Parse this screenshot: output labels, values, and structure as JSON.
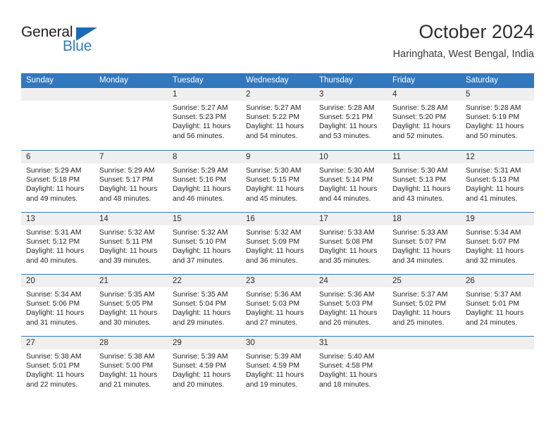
{
  "brand": {
    "name_dark": "General",
    "name_blue": "Blue",
    "accent_color": "#2b7fc4",
    "triangle_color": "#1b6cb5"
  },
  "header": {
    "month_title": "October 2024",
    "location": "Haringhata, West Bengal, India"
  },
  "theme": {
    "header_blue": "#3278be",
    "daynum_band": "#efefef",
    "text": "#262626"
  },
  "weekday_headers": [
    "Sunday",
    "Monday",
    "Tuesday",
    "Wednesday",
    "Thursday",
    "Friday",
    "Saturday"
  ],
  "weeks": [
    [
      {
        "day": "",
        "sunrise": "",
        "sunset": "",
        "daylight_a": "",
        "daylight_b": ""
      },
      {
        "day": "",
        "sunrise": "",
        "sunset": "",
        "daylight_a": "",
        "daylight_b": ""
      },
      {
        "day": "1",
        "sunrise": "Sunrise: 5:27 AM",
        "sunset": "Sunset: 5:23 PM",
        "daylight_a": "Daylight: 11 hours",
        "daylight_b": "and 56 minutes."
      },
      {
        "day": "2",
        "sunrise": "Sunrise: 5:27 AM",
        "sunset": "Sunset: 5:22 PM",
        "daylight_a": "Daylight: 11 hours",
        "daylight_b": "and 54 minutes."
      },
      {
        "day": "3",
        "sunrise": "Sunrise: 5:28 AM",
        "sunset": "Sunset: 5:21 PM",
        "daylight_a": "Daylight: 11 hours",
        "daylight_b": "and 53 minutes."
      },
      {
        "day": "4",
        "sunrise": "Sunrise: 5:28 AM",
        "sunset": "Sunset: 5:20 PM",
        "daylight_a": "Daylight: 11 hours",
        "daylight_b": "and 52 minutes."
      },
      {
        "day": "5",
        "sunrise": "Sunrise: 5:28 AM",
        "sunset": "Sunset: 5:19 PM",
        "daylight_a": "Daylight: 11 hours",
        "daylight_b": "and 50 minutes."
      }
    ],
    [
      {
        "day": "6",
        "sunrise": "Sunrise: 5:29 AM",
        "sunset": "Sunset: 5:18 PM",
        "daylight_a": "Daylight: 11 hours",
        "daylight_b": "and 49 minutes."
      },
      {
        "day": "7",
        "sunrise": "Sunrise: 5:29 AM",
        "sunset": "Sunset: 5:17 PM",
        "daylight_a": "Daylight: 11 hours",
        "daylight_b": "and 48 minutes."
      },
      {
        "day": "8",
        "sunrise": "Sunrise: 5:29 AM",
        "sunset": "Sunset: 5:16 PM",
        "daylight_a": "Daylight: 11 hours",
        "daylight_b": "and 46 minutes."
      },
      {
        "day": "9",
        "sunrise": "Sunrise: 5:30 AM",
        "sunset": "Sunset: 5:15 PM",
        "daylight_a": "Daylight: 11 hours",
        "daylight_b": "and 45 minutes."
      },
      {
        "day": "10",
        "sunrise": "Sunrise: 5:30 AM",
        "sunset": "Sunset: 5:14 PM",
        "daylight_a": "Daylight: 11 hours",
        "daylight_b": "and 44 minutes."
      },
      {
        "day": "11",
        "sunrise": "Sunrise: 5:30 AM",
        "sunset": "Sunset: 5:13 PM",
        "daylight_a": "Daylight: 11 hours",
        "daylight_b": "and 43 minutes."
      },
      {
        "day": "12",
        "sunrise": "Sunrise: 5:31 AM",
        "sunset": "Sunset: 5:13 PM",
        "daylight_a": "Daylight: 11 hours",
        "daylight_b": "and 41 minutes."
      }
    ],
    [
      {
        "day": "13",
        "sunrise": "Sunrise: 5:31 AM",
        "sunset": "Sunset: 5:12 PM",
        "daylight_a": "Daylight: 11 hours",
        "daylight_b": "and 40 minutes."
      },
      {
        "day": "14",
        "sunrise": "Sunrise: 5:32 AM",
        "sunset": "Sunset: 5:11 PM",
        "daylight_a": "Daylight: 11 hours",
        "daylight_b": "and 39 minutes."
      },
      {
        "day": "15",
        "sunrise": "Sunrise: 5:32 AM",
        "sunset": "Sunset: 5:10 PM",
        "daylight_a": "Daylight: 11 hours",
        "daylight_b": "and 37 minutes."
      },
      {
        "day": "16",
        "sunrise": "Sunrise: 5:32 AM",
        "sunset": "Sunset: 5:09 PM",
        "daylight_a": "Daylight: 11 hours",
        "daylight_b": "and 36 minutes."
      },
      {
        "day": "17",
        "sunrise": "Sunrise: 5:33 AM",
        "sunset": "Sunset: 5:08 PM",
        "daylight_a": "Daylight: 11 hours",
        "daylight_b": "and 35 minutes."
      },
      {
        "day": "18",
        "sunrise": "Sunrise: 5:33 AM",
        "sunset": "Sunset: 5:07 PM",
        "daylight_a": "Daylight: 11 hours",
        "daylight_b": "and 34 minutes."
      },
      {
        "day": "19",
        "sunrise": "Sunrise: 5:34 AM",
        "sunset": "Sunset: 5:07 PM",
        "daylight_a": "Daylight: 11 hours",
        "daylight_b": "and 32 minutes."
      }
    ],
    [
      {
        "day": "20",
        "sunrise": "Sunrise: 5:34 AM",
        "sunset": "Sunset: 5:06 PM",
        "daylight_a": "Daylight: 11 hours",
        "daylight_b": "and 31 minutes."
      },
      {
        "day": "21",
        "sunrise": "Sunrise: 5:35 AM",
        "sunset": "Sunset: 5:05 PM",
        "daylight_a": "Daylight: 11 hours",
        "daylight_b": "and 30 minutes."
      },
      {
        "day": "22",
        "sunrise": "Sunrise: 5:35 AM",
        "sunset": "Sunset: 5:04 PM",
        "daylight_a": "Daylight: 11 hours",
        "daylight_b": "and 29 minutes."
      },
      {
        "day": "23",
        "sunrise": "Sunrise: 5:36 AM",
        "sunset": "Sunset: 5:03 PM",
        "daylight_a": "Daylight: 11 hours",
        "daylight_b": "and 27 minutes."
      },
      {
        "day": "24",
        "sunrise": "Sunrise: 5:36 AM",
        "sunset": "Sunset: 5:03 PM",
        "daylight_a": "Daylight: 11 hours",
        "daylight_b": "and 26 minutes."
      },
      {
        "day": "25",
        "sunrise": "Sunrise: 5:37 AM",
        "sunset": "Sunset: 5:02 PM",
        "daylight_a": "Daylight: 11 hours",
        "daylight_b": "and 25 minutes."
      },
      {
        "day": "26",
        "sunrise": "Sunrise: 5:37 AM",
        "sunset": "Sunset: 5:01 PM",
        "daylight_a": "Daylight: 11 hours",
        "daylight_b": "and 24 minutes."
      }
    ],
    [
      {
        "day": "27",
        "sunrise": "Sunrise: 5:38 AM",
        "sunset": "Sunset: 5:01 PM",
        "daylight_a": "Daylight: 11 hours",
        "daylight_b": "and 22 minutes."
      },
      {
        "day": "28",
        "sunrise": "Sunrise: 5:38 AM",
        "sunset": "Sunset: 5:00 PM",
        "daylight_a": "Daylight: 11 hours",
        "daylight_b": "and 21 minutes."
      },
      {
        "day": "29",
        "sunrise": "Sunrise: 5:39 AM",
        "sunset": "Sunset: 4:59 PM",
        "daylight_a": "Daylight: 11 hours",
        "daylight_b": "and 20 minutes."
      },
      {
        "day": "30",
        "sunrise": "Sunrise: 5:39 AM",
        "sunset": "Sunset: 4:59 PM",
        "daylight_a": "Daylight: 11 hours",
        "daylight_b": "and 19 minutes."
      },
      {
        "day": "31",
        "sunrise": "Sunrise: 5:40 AM",
        "sunset": "Sunset: 4:58 PM",
        "daylight_a": "Daylight: 11 hours",
        "daylight_b": "and 18 minutes."
      },
      {
        "day": "",
        "sunrise": "",
        "sunset": "",
        "daylight_a": "",
        "daylight_b": ""
      },
      {
        "day": "",
        "sunrise": "",
        "sunset": "",
        "daylight_a": "",
        "daylight_b": ""
      }
    ]
  ]
}
